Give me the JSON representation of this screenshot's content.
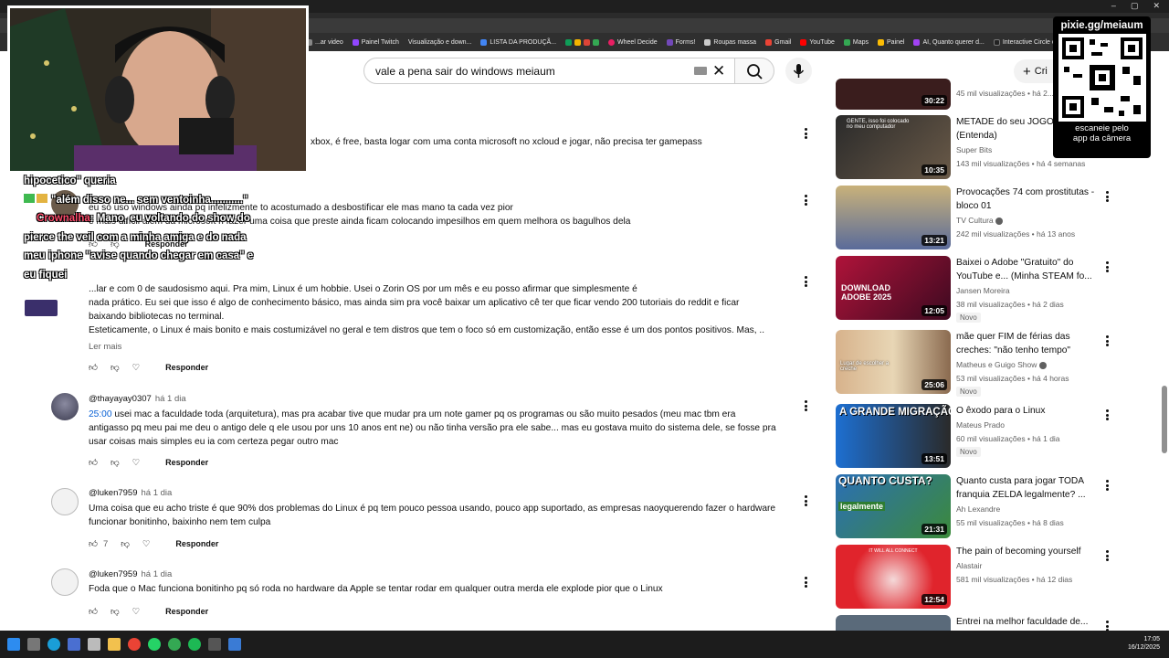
{
  "browser": {
    "bookmarks": [
      "...ar video",
      "Painel Twitch",
      "Visualização e down...",
      "LISTA DA PRODUÇÃ...",
      "Wheel Decide",
      "Forms!",
      "Roupas massa",
      "Gmail",
      "YouTube",
      "Maps",
      "Painel",
      "AI, Quanto querer d...",
      "Interactive Circle of..."
    ]
  },
  "header": {
    "search_query": "vale a pena sair do windows meiaum",
    "create_label": "Cri"
  },
  "comments": [
    {
      "lines": [
        "xbox,  é free, basta logar com uma conta microsoft no xcloud e jogar, não precisa ter gamepass"
      ]
    },
    {
      "lines": [
        "eu só uso windows ainda pq infelizmente to acostumado a desbostificar ele mas mano ta cada vez pior",
        "e mais difícil alem da microsoft n fazer uma coisa que preste ainda ficam colocando impesilhos em quem melhora os bagulhos dela"
      ],
      "reply": "Responder"
    },
    {
      "lines": [
        "...lar e com 0 de saudosismo aqui. Pra mim, Linux é um hobbie. Usei o Zorin OS por um mês e eu posso afirmar que simplesmente é",
        "nada prático. Eu sei que isso é algo de conhecimento básico, mas ainda sim pra você baixar um aplicativo cê ter que ficar vendo 200 tutoriais do reddit e ficar",
        "baixando bibliotecas no terminal.",
        "Esteticamente, o Linux é mais bonito e mais costumizável no geral e tem distros que tem o foco só em customização, então esse é um dos pontos positivos. Mas, .."
      ],
      "readmore": "Ler mais",
      "reply": "Responder"
    },
    {
      "author": "@thayayay0307",
      "time": "há 1 dia",
      "timestamp": "25:00",
      "lines": [
        " usei mac a faculdade toda (arquitetura), mas pra acabar tive que mudar pra um note gamer pq os programas ou são muito pesados (meu mac tbm era",
        "antigasso pq meu pai me deu o antigo dele q ele usou por uns 10 anos ent ne) ou não tinha versão pra ele sabe... mas eu gostava muito do sistema dele, se fosse pra",
        "usar coisas mais simples eu ia com certeza pegar outro mac"
      ],
      "reply": "Responder"
    },
    {
      "author": "@luken7959",
      "time": "há 1 dia",
      "lines": [
        "Uma coisa que eu acho triste é que 90% dos problemas do Linux é pq tem pouco pessoa usando, pouco app suportado, as empresas naoyquerendo fazer o hardware",
        "funcionar bonitinho, baixinho nem tem culpa"
      ],
      "likes": "7",
      "reply": "Responder"
    },
    {
      "author": "@luken7959",
      "time": "há 1 dia",
      "lines": [
        "Foda que o Mac funciona bonitinho pq só roda no hardware da Apple se tentar rodar em qualquer outra merda ele explode pior que o Linux"
      ],
      "reply": "Responder"
    }
  ],
  "chat": [
    {
      "user": "",
      "text": "hipocetico\" queria"
    },
    {
      "user": "",
      "text": "\"além disso ne... sem ventoinha...........\""
    },
    {
      "user": "Crownalha",
      "text": ": Mano, eu voltando do show do pierce the veil com a minha amiga e do nada meu iphone \"avise quando chegar em casa\" e eu fiquei"
    }
  ],
  "sidebar": [
    {
      "duration": "30:22",
      "title": "",
      "channel": "",
      "meta": "45 mil visualizações • há 2..."
    },
    {
      "duration": "10:35",
      "title": "METADE do seu JOGO... (Entenda)",
      "channel": "Super Bits",
      "meta": "143 mil visualizações • há 4 semanas"
    },
    {
      "duration": "13:21",
      "title": "Provocações 74 com prostitutas - bloco 01",
      "channel": "TV Cultura",
      "meta": "242 mil visualizações • há 13 anos"
    },
    {
      "duration": "12:05",
      "title": "Baixei o Adobe \"Gratuito\" do YouTube e... (Minha STEAM fo...",
      "channel": "Jansen Moreira",
      "meta": "38 mil visualizações • há 2 dias",
      "badge": "Novo"
    },
    {
      "duration": "25:06",
      "title": "mãe quer FIM de férias das creches: \"não tenho tempo\"",
      "channel": "Matheus e Guigo Show",
      "meta": "53 mil visualizações • há 4 horas",
      "badge": "Novo"
    },
    {
      "duration": "13:51",
      "title": "O êxodo para o Linux",
      "channel": "Mateus Prado",
      "meta": "60 mil visualizações • há 1 dia",
      "badge": "Novo"
    },
    {
      "duration": "21:31",
      "title": "Quanto custa para jogar TODA franquia ZELDA legalmente? ...",
      "channel": "Ah Lexandre",
      "meta": "55 mil visualizações • há 8 dias"
    },
    {
      "duration": "12:54",
      "title": "The pain of becoming yourself",
      "channel": "Alastair",
      "meta": "581 mil visualizações • há 12 dias"
    },
    {
      "duration": "",
      "title": "Entrei na melhor faculdade de...",
      "channel": "",
      "meta": ""
    }
  ],
  "thumb_texts": {
    "t2": "GENTE, isso foi colocado no meu computador",
    "t4": "DOWNLOAD ADOBE 2025",
    "t5": "Lugar de escolher a creche",
    "t6": "A GRANDE MIGRAÇÃO",
    "t7_a": "QUANTO CUSTA?",
    "t7_b": "legalmente",
    "t8": "IT WILL ALL CONNECT"
  },
  "qr": {
    "url": "pixie.gg/meiaum",
    "hint_line1": "escaneie pelo",
    "hint_line2": "app da câmera"
  },
  "clock": {
    "time": "17:05",
    "date": "16/12/2025"
  },
  "colors": {
    "accent_link": "#065fd4",
    "chat_user": "#ff4d6d"
  }
}
